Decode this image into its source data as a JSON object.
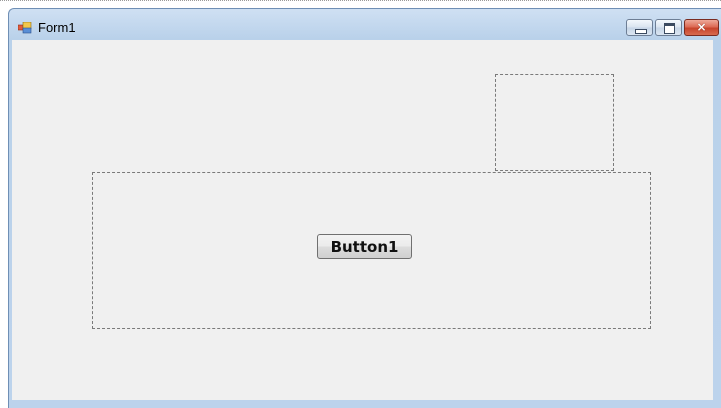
{
  "window": {
    "title": "Form1",
    "icon": "winforms-app-icon",
    "caption_buttons": {
      "minimize": "minimize-icon",
      "maximize": "maximize-icon",
      "close": "close-icon",
      "close_glyph": "×"
    }
  },
  "form": {
    "background": "#f0f0f0",
    "button1_label": "Button1"
  }
}
